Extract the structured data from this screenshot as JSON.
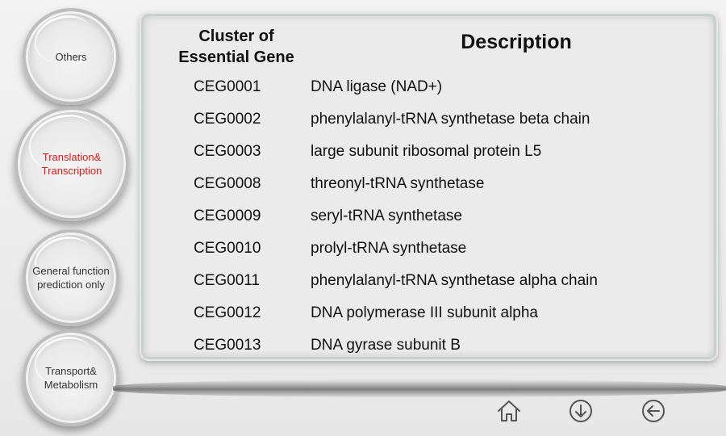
{
  "categories": [
    {
      "label_line1": "Others",
      "label_line2": "",
      "active": false
    },
    {
      "label_line1": "Translation&",
      "label_line2": "Transcription",
      "active": true
    },
    {
      "label_line1": "General function",
      "label_line2": "prediction only",
      "active": false
    },
    {
      "label_line1": "Transport&",
      "label_line2": "Metabolism",
      "active": false
    }
  ],
  "table": {
    "header_left_line1": "Cluster of",
    "header_left_line2": "Essential Gene",
    "header_right": "Description",
    "rows": [
      {
        "id": "CEG0001",
        "desc": "DNA ligase (NAD+)"
      },
      {
        "id": "CEG0002",
        "desc": "phenylalanyl-tRNA synthetase beta chain"
      },
      {
        "id": "CEG0003",
        "desc": "large subunit ribosomal protein L5"
      },
      {
        "id": "CEG0008",
        "desc": "threonyl-tRNA synthetase"
      },
      {
        "id": "CEG0009",
        "desc": "seryl-tRNA synthetase"
      },
      {
        "id": "CEG0010",
        "desc": "prolyl-tRNA synthetase"
      },
      {
        "id": "CEG0011",
        "desc": "phenylalanyl-tRNA synthetase alpha chain"
      },
      {
        "id": "CEG0012",
        "desc": "DNA polymerase III subunit alpha"
      },
      {
        "id": "CEG0013",
        "desc": "DNA gyrase subunit B"
      }
    ]
  },
  "nav_icons": [
    "home-icon",
    "arrow-down-icon",
    "arrow-left-icon"
  ],
  "colors": {
    "active_label": "#e01818",
    "text": "#111111"
  }
}
